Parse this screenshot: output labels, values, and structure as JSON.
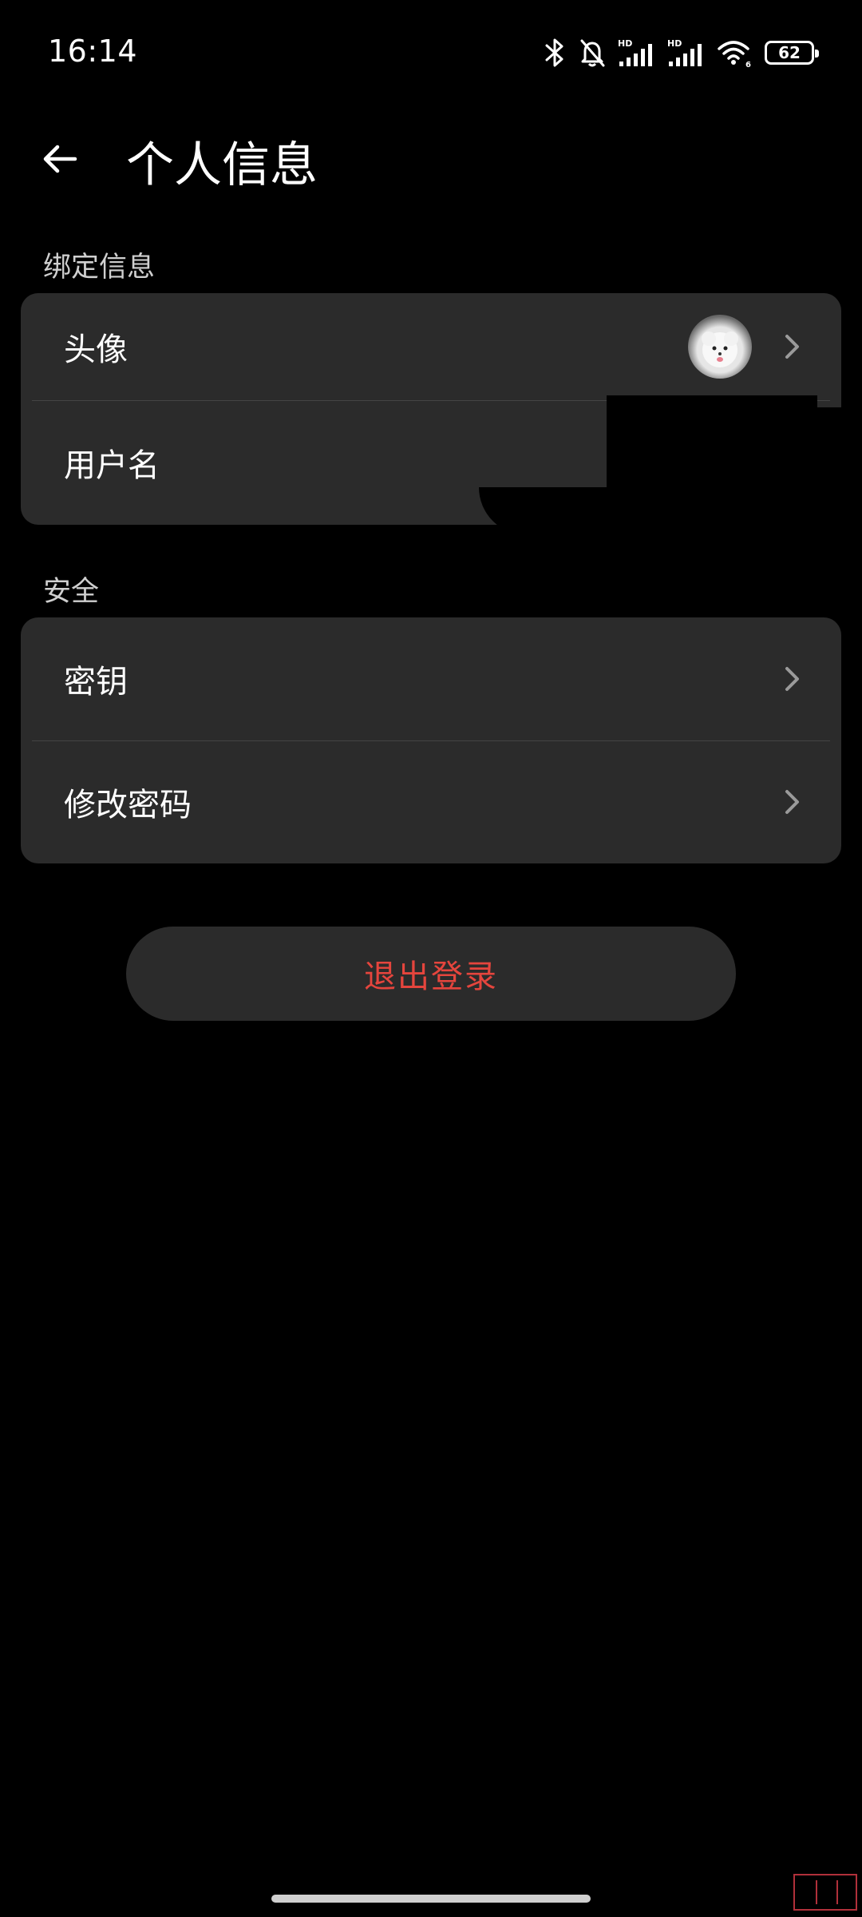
{
  "status_bar": {
    "time": "16:14",
    "battery": "62",
    "icons": [
      "bluetooth-icon",
      "bell-off-icon",
      "hd-signal-icon",
      "hd-signal-icon",
      "wifi-icon",
      "battery-icon"
    ]
  },
  "header": {
    "title": "个人信息",
    "back_icon": "arrow-left-icon"
  },
  "sections": [
    {
      "label": "绑定信息",
      "rows": [
        {
          "label": "头像",
          "trailing": "avatar",
          "icon": "chevron-right-icon"
        },
        {
          "label": "用户名"
        }
      ]
    },
    {
      "label": "安全",
      "rows": [
        {
          "label": "密钥",
          "icon": "chevron-right-icon"
        },
        {
          "label": "修改密码",
          "icon": "chevron-right-icon"
        }
      ]
    }
  ],
  "logout": {
    "label": "退出登录"
  },
  "colors": {
    "background": "#000000",
    "card": "#2b2b2b",
    "divider": "#444444",
    "logout_text": "#e5453d",
    "section_label": "#cfcfcf"
  }
}
